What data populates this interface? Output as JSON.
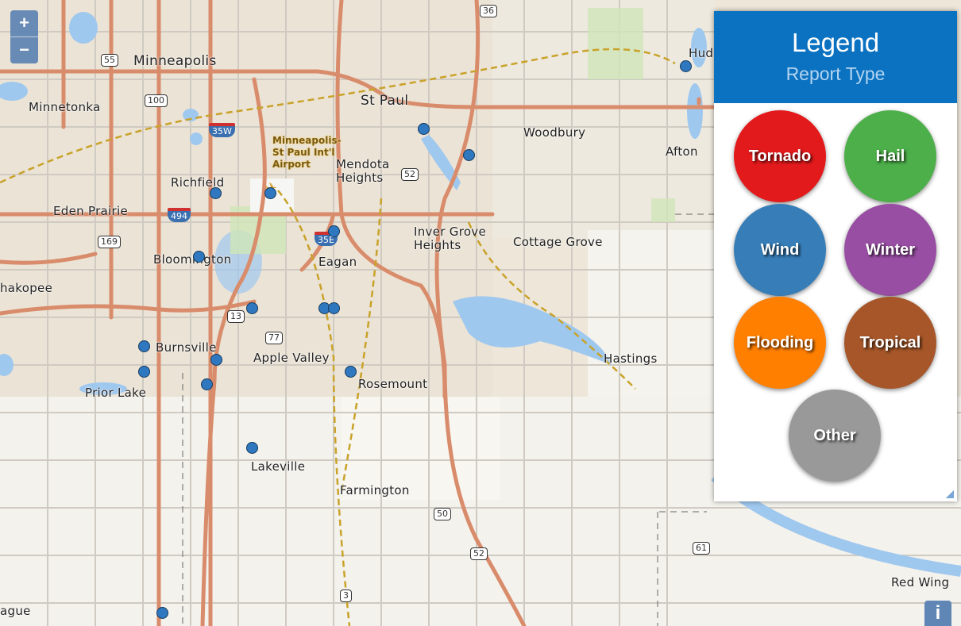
{
  "map": {
    "places": [
      {
        "name": "Minneapolis",
        "big": true
      },
      {
        "name": "St Paul",
        "big": true
      },
      {
        "name": "Minnetonka"
      },
      {
        "name": "Woodbury"
      },
      {
        "name": "Afton"
      },
      {
        "name": "Hud"
      },
      {
        "name": "Richfield"
      },
      {
        "name": "Mendota\nHeights"
      },
      {
        "name": "Eden Prairie"
      },
      {
        "name": "Inver Grove\nHeights"
      },
      {
        "name": "Cottage Grove"
      },
      {
        "name": "Bloomington"
      },
      {
        "name": "Eagan"
      },
      {
        "name": "hakopee"
      },
      {
        "name": "Burnsville"
      },
      {
        "name": "Apple Valley"
      },
      {
        "name": "Hastings"
      },
      {
        "name": "Rosemount"
      },
      {
        "name": "Prior Lake"
      },
      {
        "name": "Lakeville"
      },
      {
        "name": "Farmington"
      },
      {
        "name": "Red Wing"
      },
      {
        "name": "ague"
      }
    ],
    "airport_label": "Minneapolis-\nSt Paul Int'l\nAirport",
    "road_shields": [
      "36",
      "55",
      "100",
      "52",
      "169",
      "13",
      "77",
      "50",
      "52",
      "61",
      "3"
    ],
    "interstate_shields": [
      "35W",
      "494",
      "35E"
    ],
    "marker_color": "#2f78c0",
    "marker_count": 22
  },
  "controls": {
    "zoom_in": "+",
    "zoom_out": "−",
    "info": "i"
  },
  "legend": {
    "title": "Legend",
    "subtitle": "Report Type",
    "items": [
      {
        "label": "Tornado",
        "color": "#e31a1c"
      },
      {
        "label": "Hail",
        "color": "#4daf4a"
      },
      {
        "label": "Wind",
        "color": "#377eb8"
      },
      {
        "label": "Winter",
        "color": "#984ea3"
      },
      {
        "label": "Flooding",
        "color": "#ff7f00"
      },
      {
        "label": "Tropical",
        "color": "#a65628"
      },
      {
        "label": "Other",
        "color": "#999999"
      }
    ]
  }
}
